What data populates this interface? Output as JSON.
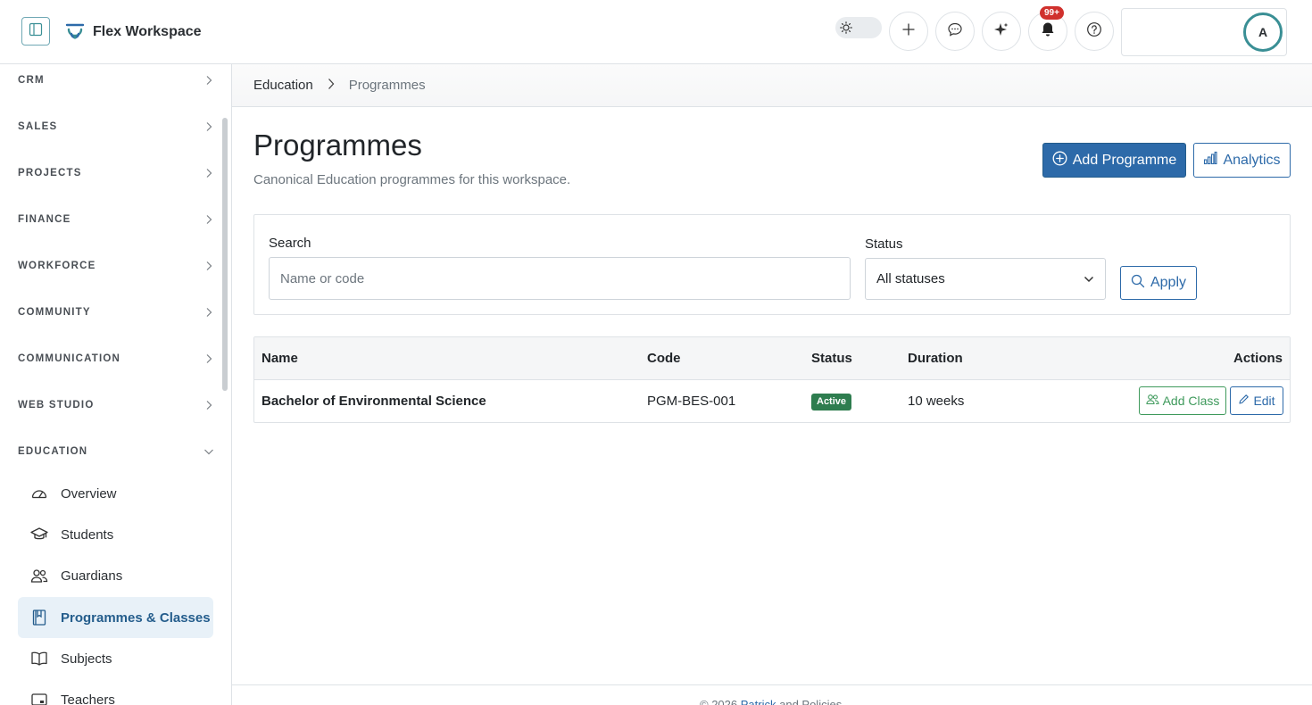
{
  "app": {
    "name": "Flex Workspace",
    "notification_count": "99+",
    "avatar_initial": "A"
  },
  "colors": {
    "primary": "#2d6aa9",
    "success": "#3f9a5c",
    "active_badge": "#2e7d4f",
    "sidebar_active_bg": "#e8f1f8",
    "avatar_ring": "#3a8f95"
  },
  "header": {
    "icons": [
      "sidebar-toggle-icon",
      "logo-icon",
      "sun-icon",
      "plus-icon",
      "chat-icon",
      "sparkle-icon",
      "bell-icon",
      "help-icon"
    ]
  },
  "sidebar": {
    "sections": [
      {
        "label": "CRM",
        "expanded": false
      },
      {
        "label": "SALES",
        "expanded": false
      },
      {
        "label": "PROJECTS",
        "expanded": false
      },
      {
        "label": "FINANCE",
        "expanded": false
      },
      {
        "label": "WORKFORCE",
        "expanded": false
      },
      {
        "label": "COMMUNITY",
        "expanded": false
      },
      {
        "label": "COMMUNICATION",
        "expanded": false
      },
      {
        "label": "WEB STUDIO",
        "expanded": false
      },
      {
        "label": "EDUCATION",
        "expanded": true
      }
    ],
    "education_items": [
      {
        "label": "Overview",
        "icon": "gauge-icon",
        "active": false
      },
      {
        "label": "Students",
        "icon": "graduation-cap-icon",
        "active": false
      },
      {
        "label": "Guardians",
        "icon": "people-icon",
        "active": false
      },
      {
        "label": "Programmes & Classes",
        "icon": "bookmark-book-icon",
        "active": true
      },
      {
        "label": "Subjects",
        "icon": "open-book-icon",
        "active": false
      },
      {
        "label": "Teachers",
        "icon": "teacher-icon",
        "active": false
      }
    ]
  },
  "breadcrumb": {
    "items": [
      "Education",
      "Programmes"
    ]
  },
  "page": {
    "title": "Programmes",
    "subtitle": "Canonical Education programmes for this workspace.",
    "add_button": "Add Programme",
    "analytics_button": "Analytics"
  },
  "filters": {
    "search_label": "Search",
    "search_placeholder": "Name or code",
    "status_label": "Status",
    "status_value": "All statuses",
    "apply_button": "Apply"
  },
  "table": {
    "columns": [
      "Name",
      "Code",
      "Status",
      "Duration",
      "Actions"
    ],
    "rows": [
      {
        "name": "Bachelor of Environmental Science",
        "code": "PGM-BES-001",
        "status": "Active",
        "duration": "10 weeks",
        "actions": [
          "Add Class",
          "Edit"
        ]
      }
    ]
  },
  "footer": {
    "text_prefix": "© 2026",
    "link_text": "Patrick",
    "text_suffix": "and Policies"
  }
}
